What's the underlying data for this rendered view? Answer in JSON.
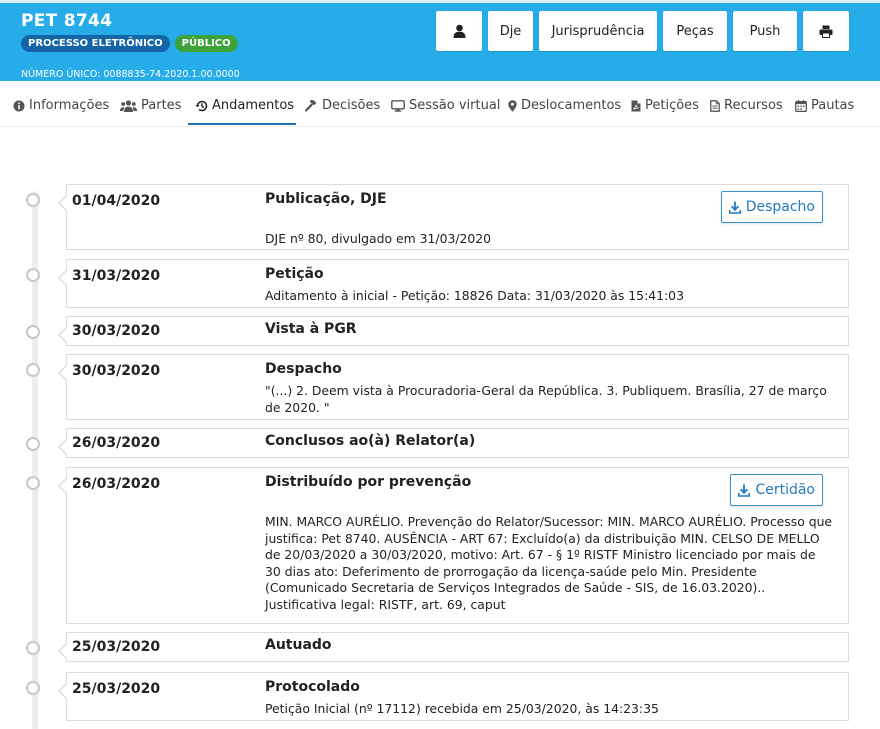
{
  "header": {
    "title": "PET 8744",
    "badges": [
      "PROCESSO ELETRÔNICO",
      "PÚBLICO"
    ],
    "numero_unico": "NÚMERO ÚNICO: 0088835-74.2020.1.00.0000",
    "buttons": [
      {
        "label": "",
        "icon": "user-icon"
      },
      {
        "label": "Dje"
      },
      {
        "label": "Jurisprudência"
      },
      {
        "label": "Peças"
      },
      {
        "label": "Push"
      },
      {
        "label": "",
        "icon": "print-icon"
      }
    ],
    "colors": {
      "header_bg": "#27acea",
      "badge_blue": "#1464a8",
      "badge_green": "#3ea23a"
    }
  },
  "tabs": [
    {
      "label": "Informações",
      "icon": "info-icon"
    },
    {
      "label": "Partes",
      "icon": "users-icon"
    },
    {
      "label": "Andamentos",
      "icon": "history-icon",
      "active": true
    },
    {
      "label": "Decisões",
      "icon": "gavel-icon"
    },
    {
      "label": "Sessão virtual",
      "icon": "monitor-icon"
    },
    {
      "label": "Deslocamentos",
      "icon": "map-marker-icon"
    },
    {
      "label": "Petições",
      "icon": "pdf-file-icon"
    },
    {
      "label": "Recursos",
      "icon": "file-icon"
    },
    {
      "label": "Pautas",
      "icon": "calendar-icon"
    }
  ],
  "events": [
    {
      "date": "01/04/2020",
      "title": "Publicação, DJE",
      "desc": "DJE nº 80, divulgado em 31/03/2020",
      "button": "Despacho"
    },
    {
      "date": "31/03/2020",
      "title": "Petição",
      "desc": "Aditamento à inicial - Petição: 18826 Data: 31/03/2020 às 15:41:03"
    },
    {
      "date": "30/03/2020",
      "title": "Vista à PGR",
      "desc": ""
    },
    {
      "date": "30/03/2020",
      "title": "Despacho",
      "desc": "\"(...) 2. Deem vista à Procuradoria-Geral da República. 3. Publiquem. Brasília, 27 de março de 2020. \""
    },
    {
      "date": "26/03/2020",
      "title": "Conclusos ao(à) Relator(a)",
      "desc": ""
    },
    {
      "date": "26/03/2020",
      "title": "Distribuído por prevenção",
      "desc": "MIN. MARCO AURÉLIO. Prevenção do Relator/Sucessor: MIN. MARCO AURÉLIO. Processo que justifica: Pet 8740. AUSÊNCIA - ART 67: Excluído(a) da distribuição MIN. CELSO DE MELLO de 20/03/2020 a 30/03/2020, motivo: Art. 67 - § 1º RISTF Ministro licenciado por mais de 30 dias ato: Deferimento de prorrogação da licença-saúde pelo Min. Presidente (Comunicado Secretaria de Serviços Integrados de Saúde - SIS, de 16.03.2020).. Justificativa legal: RISTF, art. 69, caput",
      "button": "Certidão"
    },
    {
      "date": "25/03/2020",
      "title": "Autuado",
      "desc": ""
    },
    {
      "date": "25/03/2020",
      "title": "Protocolado",
      "desc": "Petição Inicial (nº 17112) recebida em 25/03/2020, às 14:23:35"
    }
  ]
}
